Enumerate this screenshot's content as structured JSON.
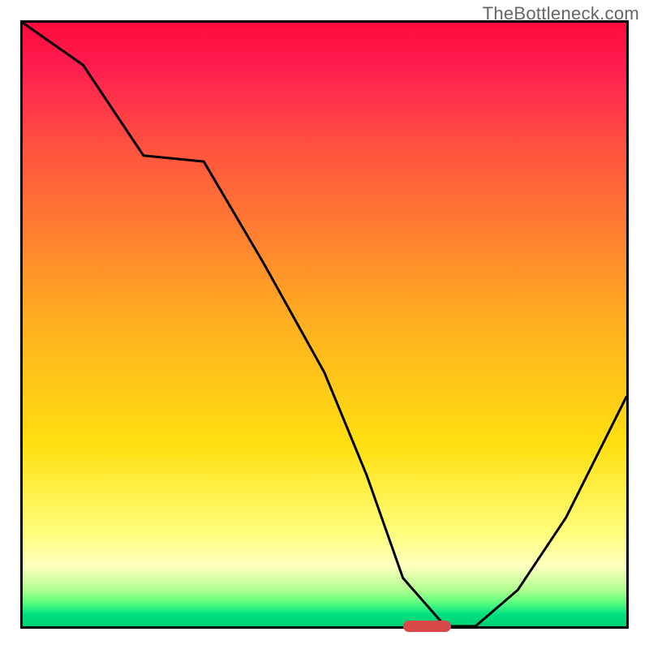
{
  "watermark": "TheBottleneck.com",
  "chart_data": {
    "type": "line",
    "title": "",
    "xlabel": "",
    "ylabel": "",
    "x": [
      0.0,
      0.1,
      0.2,
      0.3,
      0.4,
      0.5,
      0.57,
      0.63,
      0.7,
      0.75,
      0.82,
      0.9,
      1.0
    ],
    "y": [
      1.0,
      0.93,
      0.78,
      0.77,
      0.6,
      0.42,
      0.25,
      0.08,
      0.0,
      0.0,
      0.06,
      0.18,
      0.38
    ],
    "xlim": [
      0,
      1
    ],
    "ylim": [
      0,
      1
    ],
    "gradient_stops": [
      {
        "pos": 0.0,
        "color": "#ff0a3c"
      },
      {
        "pos": 0.2,
        "color": "#ff5040"
      },
      {
        "pos": 0.5,
        "color": "#ffb020"
      },
      {
        "pos": 0.7,
        "color": "#ffe010"
      },
      {
        "pos": 0.85,
        "color": "#ffff80"
      },
      {
        "pos": 0.94,
        "color": "#b0ff90"
      },
      {
        "pos": 1.0,
        "color": "#00d070"
      }
    ],
    "marker": {
      "x_center": 0.67,
      "width": 0.08,
      "color": "#d84a4a"
    }
  }
}
